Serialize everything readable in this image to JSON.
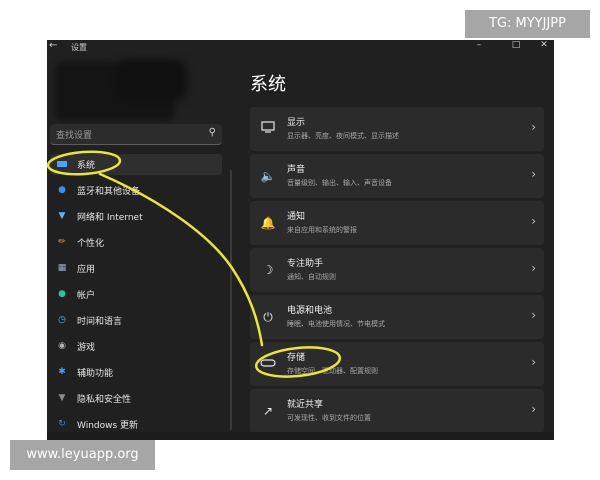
{
  "window": {
    "title": "设置",
    "back_icon": "back-arrow-icon",
    "controls": [
      "minimize-icon",
      "maximize-icon",
      "close-icon"
    ]
  },
  "sidebar": {
    "search_placeholder": "查找设置",
    "items": [
      {
        "label": "系统",
        "icon": "monitor-icon",
        "color": "#4aa3ff",
        "active": true
      },
      {
        "label": "蓝牙和其他设备",
        "icon": "bluetooth-icon",
        "color": "#3b8de8"
      },
      {
        "label": "网络和 Internet",
        "icon": "wifi-icon",
        "color": "#5fb0ff"
      },
      {
        "label": "个性化",
        "icon": "brush-icon",
        "color": "#e0a060"
      },
      {
        "label": "应用",
        "icon": "apps-icon",
        "color": "#a0b0c8"
      },
      {
        "label": "帐户",
        "icon": "person-icon",
        "color": "#2ec09a"
      },
      {
        "label": "时间和语言",
        "icon": "globe-clock-icon",
        "color": "#5ab0f0"
      },
      {
        "label": "游戏",
        "icon": "gamepad-icon",
        "color": "#b0b0b0"
      },
      {
        "label": "辅助功能",
        "icon": "accessibility-icon",
        "color": "#3ca0ff"
      },
      {
        "label": "隐私和安全性",
        "icon": "shield-icon",
        "color": "#8a8a8a"
      },
      {
        "label": "Windows 更新",
        "icon": "update-icon",
        "color": "#3b8de8"
      }
    ]
  },
  "main": {
    "title": "系统",
    "cards": [
      {
        "title": "显示",
        "subtitle": "显示器、亮度、夜间模式、显示描述",
        "icon": "display-icon"
      },
      {
        "title": "声音",
        "subtitle": "音量级别、输出、输入、声音设备",
        "icon": "speaker-icon"
      },
      {
        "title": "通知",
        "subtitle": "来自应用和系统的警报",
        "icon": "bell-icon"
      },
      {
        "title": "专注助手",
        "subtitle": "通知、自动规则",
        "icon": "moon-icon"
      },
      {
        "title": "电源和电池",
        "subtitle": "睡眠、电池使用情况、节电模式",
        "icon": "power-icon"
      },
      {
        "title": "存储",
        "subtitle": "存储空间、驱动器、配置规则",
        "icon": "storage-icon"
      },
      {
        "title": "就近共享",
        "subtitle": "可发现性、收到文件的位置",
        "icon": "share-icon"
      }
    ]
  },
  "annotation": {
    "color": "#e8e830"
  },
  "watermarks": {
    "top_right": "TG: MYYJJPP",
    "bottom_left": "www.leyuapp.org"
  }
}
